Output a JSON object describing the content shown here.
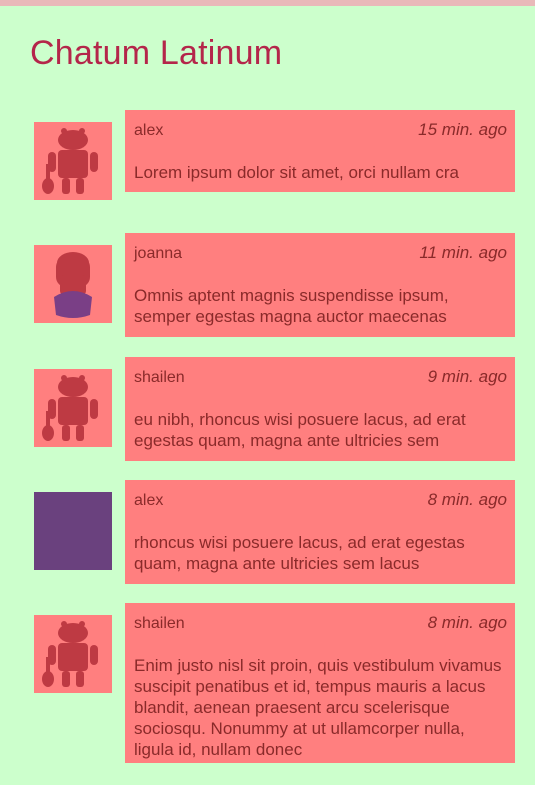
{
  "app": {
    "title": "Chatum Latinum"
  },
  "colors": {
    "background": "#ccffcc",
    "card": "#ff7f7f",
    "title": "#b4264a",
    "text": "#8a2a2a",
    "purple_avatar": "#6a417e"
  },
  "messages": [
    {
      "user": "alex",
      "time": "15 min. ago",
      "text": "Lorem ipsum dolor sit amet, orci nullam cra",
      "avatar": "android-guitar-avatar"
    },
    {
      "user": "joanna",
      "time": "11 min. ago",
      "text": "Omnis aptent magnis suspendisse ipsum, semper egestas magna auctor maecenas",
      "avatar": "android-girl-avatar"
    },
    {
      "user": "shailen",
      "time": "9 min. ago",
      "text": "eu nibh, rhoncus wisi posuere lacus, ad erat egestas quam, magna ante ultricies sem",
      "avatar": "android-guitar-avatar"
    },
    {
      "user": "alex",
      "time": "8 min. ago",
      "text": "rhoncus wisi posuere lacus, ad erat egestas quam, magna ante ultricies sem lacus",
      "avatar": "purple-square-avatar"
    },
    {
      "user": "shailen",
      "time": "8 min. ago",
      "text": "Enim justo nisl sit proin, quis vestibulum vivamus suscipit penatibus et id, tempus mauris a lacus blandit, aenean praesent arcu scelerisque sociosqu. Nonummy at ut ullamcorper nulla, ligula id, nullam donec",
      "avatar": "android-guitar-avatar"
    }
  ]
}
